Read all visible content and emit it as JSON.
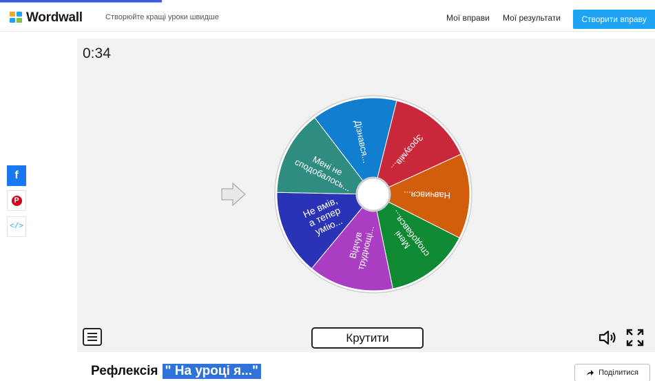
{
  "header": {
    "logo_text": "Wordwall",
    "tagline": "Створюйте кращі уроки швидше",
    "nav": [
      "Мої вправи",
      "Мої результати"
    ],
    "create_button": "Створити вправу"
  },
  "activity": {
    "timer": "0:34",
    "segments": [
      {
        "label": [
          "Зрозумів..."
        ],
        "color": "#c8283a"
      },
      {
        "label": [
          "Навчився..."
        ],
        "color": "#d25e0c"
      },
      {
        "label": [
          "Мені",
          "сподобався..."
        ],
        "color": "#0f8a32"
      },
      {
        "label": [
          "Відчув",
          "труднощі..."
        ],
        "color": "#a93ec2"
      },
      {
        "label": [
          "Не вмів,",
          "а тепер",
          "умію..."
        ],
        "color": "#2a33b5"
      },
      {
        "label": [
          "Мені не",
          "сподобалось..."
        ],
        "color": "#2e8d80"
      },
      {
        "label": [
          "Дізнався..."
        ],
        "color": "#127ed0"
      }
    ],
    "spin_button": "Крутити"
  },
  "social": {
    "facebook": "f",
    "pinterest": "P",
    "embed": "</>"
  },
  "footer": {
    "title_prefix": "Рефлексія",
    "title_highlight": "\" На уроці я...\"",
    "share_button": "Поділитися"
  },
  "icons": {
    "menu": "menu-icon",
    "sound": "speaker-icon",
    "fullscreen": "fullscreen-icon",
    "share": "share-arrow-icon",
    "pointer": "arrow-pointer-icon"
  }
}
